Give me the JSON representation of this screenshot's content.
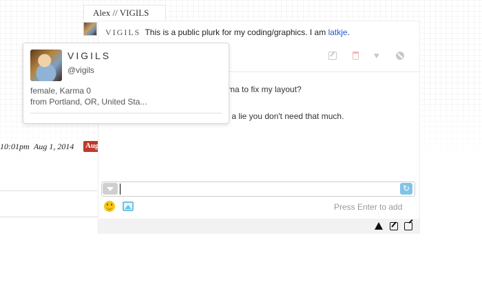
{
  "owner_tab": {
    "label": "Alex // VIGILS"
  },
  "plurk": {
    "author_display": "VIGILS",
    "text": "This is a public plurk for my coding/graphics. I am",
    "link_text": "latkje",
    "end_punct": "."
  },
  "responses": [
    {
      "text": "rma to fix my layout?"
    },
    {
      "text": "s a lie you don't need that much."
    }
  ],
  "timeline": {
    "time": "10:01pm",
    "date": "Aug 1, 2014",
    "badge": "Aug",
    "badge_color": "#c0392b"
  },
  "reply": {
    "hint": "Press Enter to add",
    "qualifier_icon": "chevron-down-icon",
    "refresh_icon": "refresh-icon",
    "emoticon_icon": "smiley-icon",
    "image_icon": "image-icon"
  },
  "bottom_bar": {
    "icons": [
      "warning-icon",
      "edit-icon",
      "open-external-icon"
    ]
  },
  "popup": {
    "display_name": "VIGILS",
    "handle": "@vigils",
    "stats": "female,  Karma 0",
    "location": "from Portland, OR, United Sta..."
  },
  "colors": {
    "link": "#2255cc",
    "accent_blue": "#7fc4e8"
  }
}
